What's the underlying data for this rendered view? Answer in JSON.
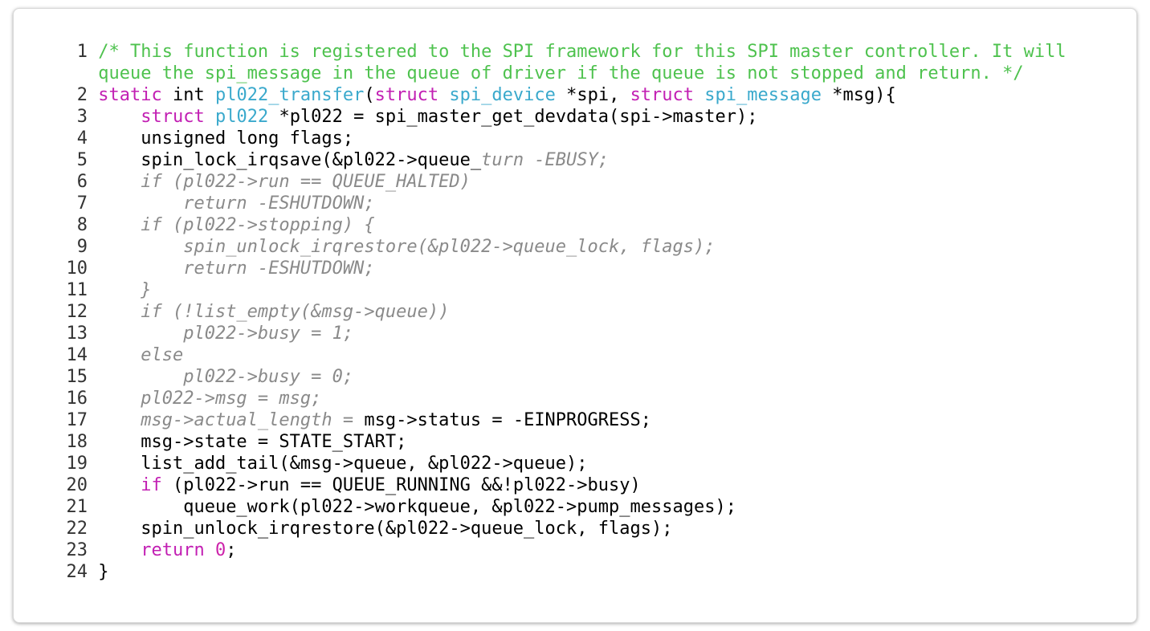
{
  "colors": {
    "comment": "#4ec24e",
    "keyword": "#c21fb3",
    "type": "#3aa9cc",
    "ghost": "#8a8a8a",
    "plain": "#000000"
  },
  "code_lines": [
    {
      "n": "1",
      "toks": [
        [
          "c",
          "/* This function is registered to the SPI framework for this SPI master controller. It will"
        ]
      ]
    },
    {
      "n": "",
      "toks": [
        [
          "c",
          "queue the spi_message in the queue of driver if the queue is not stopped and return. */"
        ]
      ]
    },
    {
      "n": "2",
      "toks": [
        [
          "k",
          "static"
        ],
        [
          "p",
          " int "
        ],
        [
          "t",
          "pl022_transfer"
        ],
        [
          "p",
          "("
        ],
        [
          "k",
          "struct"
        ],
        [
          "p",
          " "
        ],
        [
          "t",
          "spi_device"
        ],
        [
          "p",
          " *spi, "
        ],
        [
          "k",
          "struct"
        ],
        [
          "p",
          " "
        ],
        [
          "t",
          "spi_message"
        ],
        [
          "p",
          " *msg){"
        ]
      ]
    },
    {
      "n": "3",
      "toks": [
        [
          "p",
          "    "
        ],
        [
          "k",
          "struct"
        ],
        [
          "p",
          " "
        ],
        [
          "t",
          "pl022"
        ],
        [
          "p",
          " *pl022 = spi_master_get_devdata(spi->master);"
        ]
      ]
    },
    {
      "n": "4",
      "toks": [
        [
          "p",
          "    unsigned long flags;"
        ]
      ]
    },
    {
      "n": "5",
      "toks": [
        [
          "p",
          "    spin_lock_irqsave(&pl022->queue_"
        ],
        [
          "g",
          "turn -EBUSY;"
        ]
      ]
    },
    {
      "n": "6",
      "toks": [
        [
          "g",
          "    if (pl022->run == QUEUE_HALTED)"
        ]
      ]
    },
    {
      "n": "7",
      "toks": [
        [
          "g",
          "        return -ESHUTDOWN;"
        ]
      ]
    },
    {
      "n": "8",
      "toks": [
        [
          "g",
          "    if (pl022->stopping) {"
        ]
      ]
    },
    {
      "n": "9",
      "toks": [
        [
          "g",
          "        spin_unlock_irqrestore(&pl022->queue_lock, flags);"
        ]
      ]
    },
    {
      "n": "10",
      "toks": [
        [
          "g",
          "        return -ESHUTDOWN;"
        ]
      ]
    },
    {
      "n": "11",
      "toks": [
        [
          "g",
          "    }"
        ]
      ]
    },
    {
      "n": "12",
      "toks": [
        [
          "g",
          "    if (!list_empty(&msg->queue))"
        ]
      ]
    },
    {
      "n": "13",
      "toks": [
        [
          "g",
          "        pl022->busy = 1;"
        ]
      ]
    },
    {
      "n": "14",
      "toks": [
        [
          "g",
          "    else"
        ]
      ]
    },
    {
      "n": "15",
      "toks": [
        [
          "g",
          "        pl022->busy = 0;"
        ]
      ]
    },
    {
      "n": "16",
      "toks": [
        [
          "g",
          "    pl022->msg = msg;"
        ]
      ]
    },
    {
      "n": "17",
      "toks": [
        [
          "g",
          "    msg->actual_length = "
        ],
        [
          "p",
          "msg->status = -EINPROGRESS;"
        ]
      ]
    },
    {
      "n": "18",
      "toks": [
        [
          "p",
          "    msg->state = STATE_START;"
        ]
      ]
    },
    {
      "n": "19",
      "toks": [
        [
          "p",
          "    list_add_tail(&msg->queue, &pl022->queue);"
        ]
      ]
    },
    {
      "n": "20",
      "toks": [
        [
          "p",
          "    "
        ],
        [
          "k",
          "if"
        ],
        [
          "p",
          " (pl022->run == QUEUE_RUNNING &&!pl022->busy)"
        ]
      ]
    },
    {
      "n": "21",
      "toks": [
        [
          "p",
          "        queue_work(pl022->workqueue, &pl022->pump_messages);"
        ]
      ]
    },
    {
      "n": "22",
      "toks": [
        [
          "p",
          "    spin_unlock_irqrestore(&pl022->queue_lock, flags);"
        ]
      ]
    },
    {
      "n": "23",
      "toks": [
        [
          "p",
          "    "
        ],
        [
          "k",
          "return"
        ],
        [
          "p",
          " "
        ],
        [
          "n",
          "0"
        ],
        [
          "p",
          ";"
        ]
      ]
    },
    {
      "n": "24",
      "toks": [
        [
          "p",
          "}"
        ]
      ]
    }
  ]
}
